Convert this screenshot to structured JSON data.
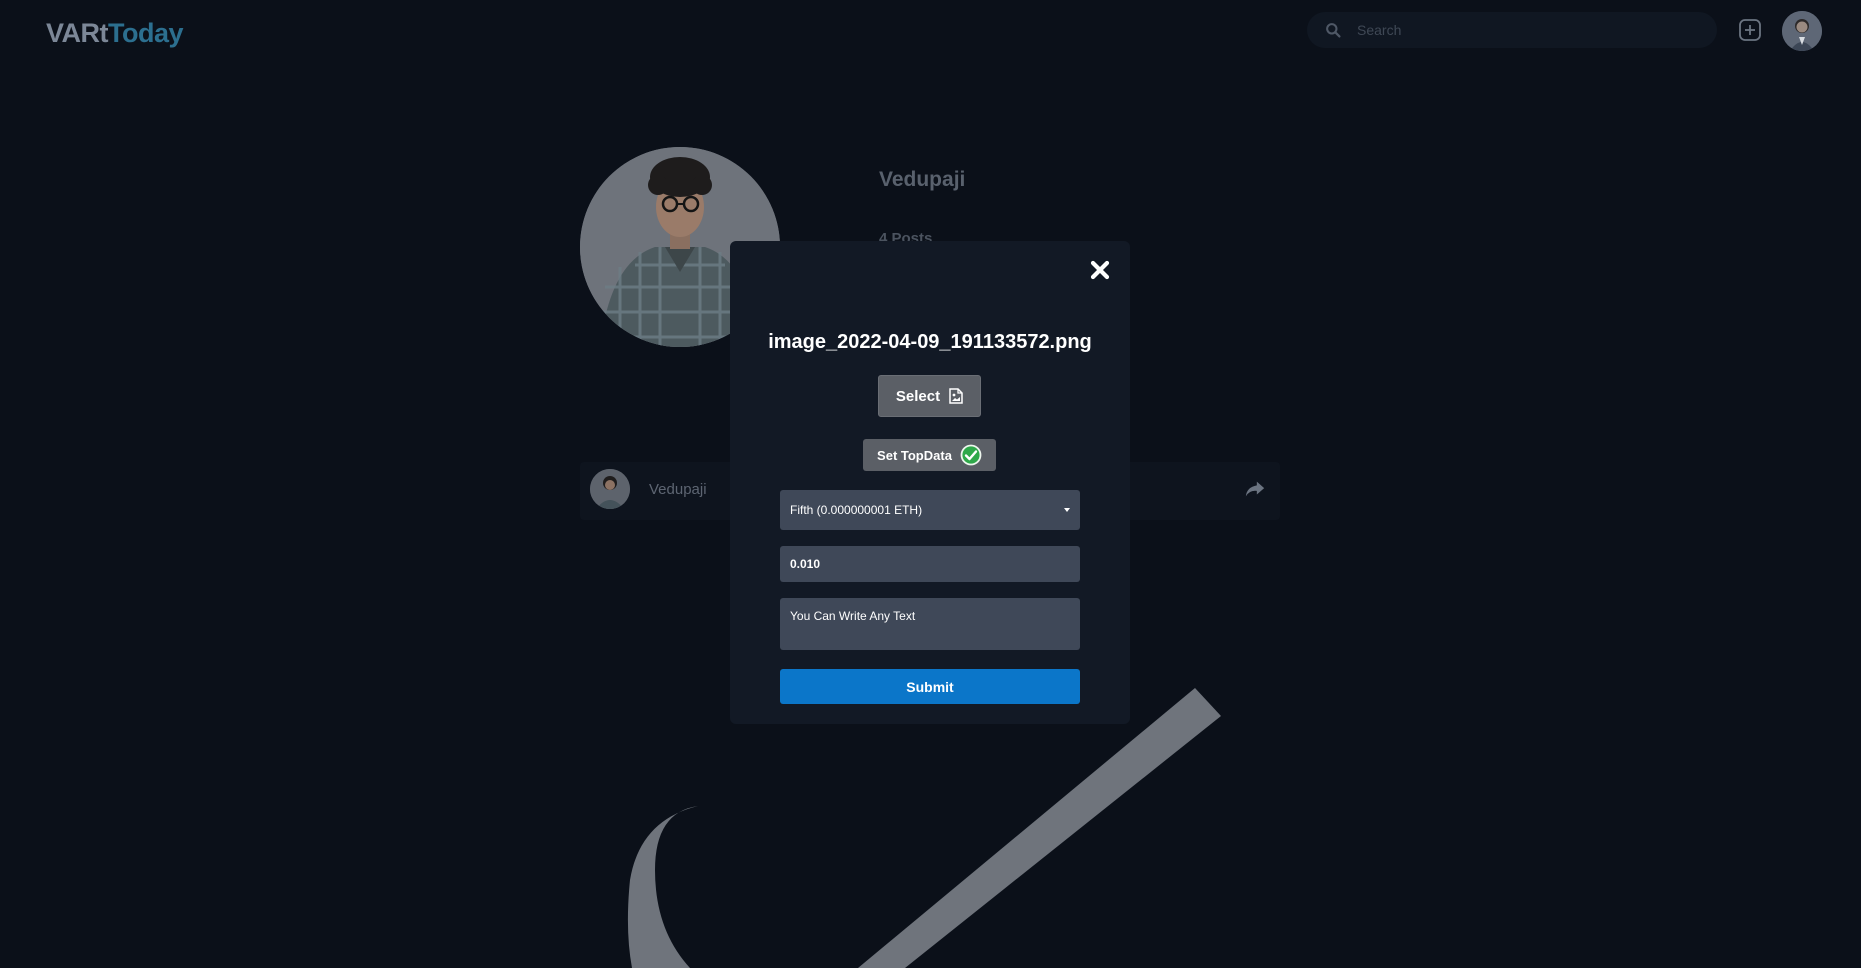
{
  "header": {
    "logo_part1": "VARt",
    "logo_part2": "Today",
    "search_placeholder": "Search"
  },
  "profile": {
    "name": "Vedupaji",
    "posts": "4 Posts"
  },
  "post": {
    "username": "Vedupaji"
  },
  "modal": {
    "file_name": "image_2022-04-09_191133572.png",
    "select_label": "Select",
    "topdata_label": "Set TopData",
    "dropdown_value": "Fifth (0.000000001 ETH)",
    "amount_value": "0.010",
    "message_value": "You Can Write Any Text",
    "submit_label": "Submit"
  },
  "colors": {
    "background": "#0b1019",
    "modal": "#121925",
    "field": "#3f4858",
    "button_gray": "#5b5f66",
    "submit_blue": "#0b76c9",
    "check_green": "#3ec94a",
    "logo_accent": "#2c6f8f"
  }
}
